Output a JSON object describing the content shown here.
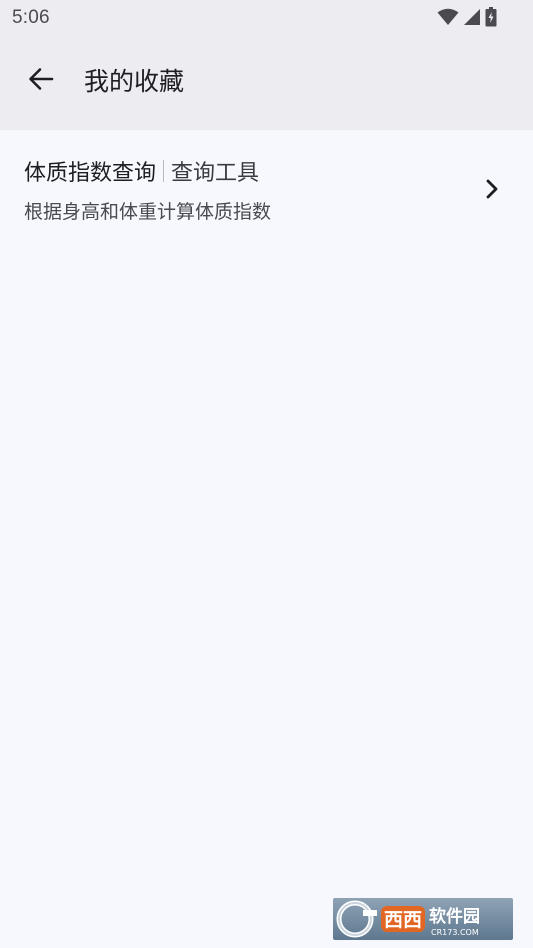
{
  "status_bar": {
    "time": "5:06",
    "icons": [
      "wifi-icon",
      "signal-icon",
      "battery-charging-icon"
    ]
  },
  "app_bar": {
    "back_icon": "arrow-back-icon",
    "title": "我的收藏"
  },
  "favorites": [
    {
      "title": "体质指数查询",
      "category": "查询工具",
      "description": "根据身高和体重计算体质指数",
      "trailing_icon": "chevron-right-icon"
    }
  ],
  "watermark": {
    "brand": "西西软件园",
    "site": "CR173.COM"
  },
  "colors": {
    "app_bar_bg": "#ececf1",
    "content_bg": "#f6f8fd",
    "text_primary": "#1e1e22"
  }
}
